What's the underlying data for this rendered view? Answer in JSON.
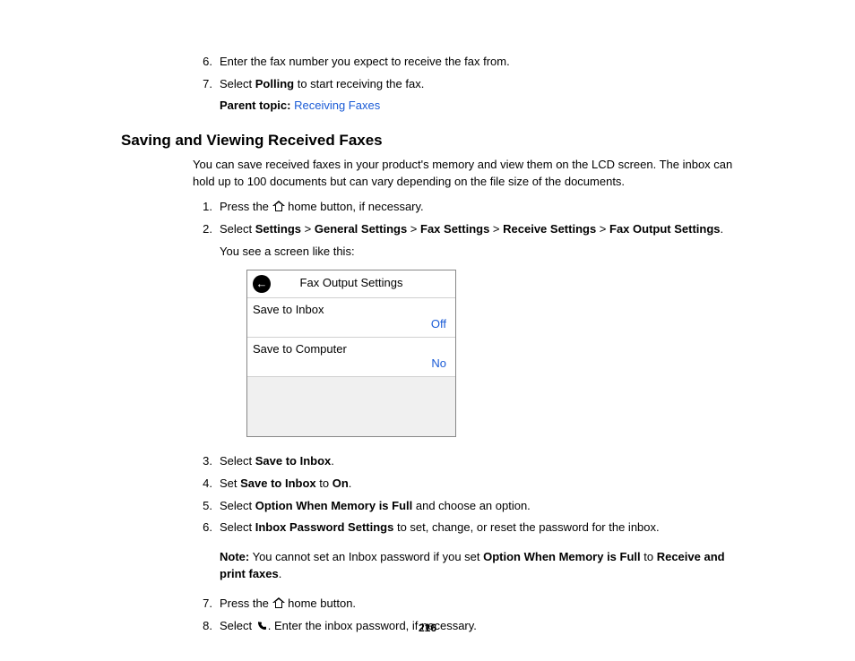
{
  "top_steps": [
    {
      "num": "6.",
      "text": "Enter the fax number you expect to receive the fax from."
    },
    {
      "num": "7.",
      "pre": "Select ",
      "bold": "Polling",
      "post": " to start receiving the fax."
    }
  ],
  "parent_topic": {
    "label": "Parent topic:",
    "link": "Receiving Faxes"
  },
  "section_title": "Saving and Viewing Received Faxes",
  "intro": "You can save received faxes in your product's memory and view them on the LCD screen. The inbox can hold up to 100 documents but can vary depending on the file size of the documents.",
  "steps_a": {
    "s1": {
      "num": "1.",
      "pre": "Press the ",
      "post": " home button, if necessary."
    },
    "s2": {
      "num": "2.",
      "pre": "Select ",
      "p1": "Settings",
      "sep": " > ",
      "p2": "General Settings",
      "p3": "Fax Settings",
      "p4": "Receive Settings",
      "p5": "Fax Output Settings",
      "end": ".",
      "sub": "You see a screen like this:"
    }
  },
  "lcd": {
    "title": "Fax Output Settings",
    "row1": {
      "label": "Save to Inbox",
      "value": "Off"
    },
    "row2": {
      "label": "Save to Computer",
      "value": "No"
    }
  },
  "steps_b": {
    "s3": {
      "num": "3.",
      "pre": "Select ",
      "b1": "Save to Inbox",
      "post": "."
    },
    "s4": {
      "num": "4.",
      "pre": "Set ",
      "b1": "Save to Inbox",
      "mid": " to ",
      "b2": "On",
      "post": "."
    },
    "s5": {
      "num": "5.",
      "pre": "Select ",
      "b1": "Option When Memory is Full",
      "post": " and choose an option."
    },
    "s6": {
      "num": "6.",
      "pre": "Select ",
      "b1": "Inbox Password Settings",
      "post": " to set, change, or reset the password for the inbox."
    }
  },
  "note": {
    "label": "Note:",
    "t1": " You cannot set an Inbox password if you set ",
    "b1": "Option When Memory is Full",
    "t2": " to ",
    "b2": "Receive and print faxes",
    "t3": "."
  },
  "steps_c": {
    "s7": {
      "num": "7.",
      "pre": "Press the ",
      "post": " home button."
    },
    "s8": {
      "num": "8.",
      "pre": "Select ",
      "post": ". Enter the inbox password, if necessary."
    }
  },
  "page_number": "216"
}
